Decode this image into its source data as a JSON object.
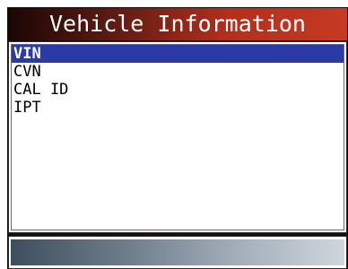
{
  "title": "Vehicle Information",
  "menu": {
    "items": [
      {
        "label": "VIN",
        "selected": true
      },
      {
        "label": "CVN",
        "selected": false
      },
      {
        "label": "CAL ID",
        "selected": false
      },
      {
        "label": "IPT",
        "selected": false
      }
    ]
  },
  "colors": {
    "title_gradient_start": "#1a0605",
    "title_gradient_end": "#c53a22",
    "selection": "#2b3aa5",
    "status_gradient_start": "#3f4e5e",
    "status_gradient_end": "#cfd6dd"
  }
}
